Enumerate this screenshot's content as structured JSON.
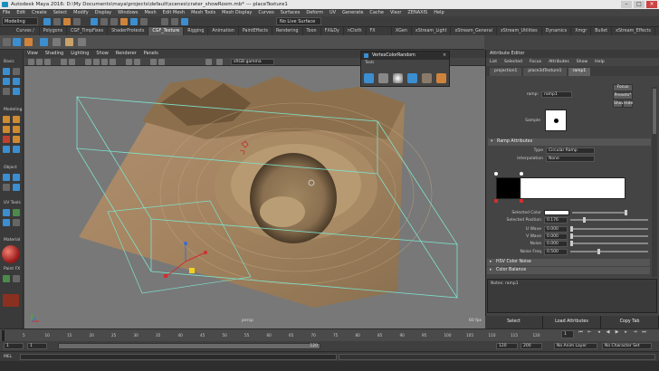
{
  "window": {
    "title": "Autodesk Maya 2016: D:\\My Documents\\maya\\projects\\default\\scenes\\crater_showRoom.mb*  ---  placeTexture1",
    "buttons": [
      "–",
      "□",
      "×"
    ]
  },
  "menubar": [
    "File",
    "Edit",
    "Create",
    "Select",
    "Modify",
    "Display",
    "Windows",
    "Mesh",
    "Edit Mesh",
    "Mesh Tools",
    "Mesh Display",
    "Curves",
    "Surfaces",
    "Deform",
    "UV",
    "Generate",
    "Cache",
    "Visor",
    "ZENAXIS",
    "Help"
  ],
  "statusline": {
    "mode": "Modeling",
    "no_live_surface": "No Live Surface",
    "icons": [
      "folder-icon",
      "save-icon",
      "undo-icon",
      "redo-icon",
      "select-icon",
      "lasso-icon",
      "paint-icon",
      "snap-grid-icon",
      "snap-curve-icon",
      "snap-point-icon",
      "render-icon",
      "ipr-icon",
      "render-settings-icon"
    ]
  },
  "shelf_tabs": [
    "Curves / Surfaces",
    "Polygons",
    "CGF_TimpFixes",
    "ShaderProtests",
    "CGF_Texture",
    "Rigging",
    "Animation",
    "PaintEffects",
    "Rendering",
    "Toon",
    "FX&Dy",
    "nCloth",
    "FX Caching",
    "XGen",
    "xStream_Light",
    "xStream_General",
    "xStream_Utilities",
    "Dynamics",
    "Xmgr",
    "Bullet",
    "xStream_Effects",
    "AdvSkeleton"
  ],
  "shelf_active": 4,
  "toolbox": {
    "labels": [
      "Basic",
      "Modeling",
      "Object",
      "UV Tools",
      "Material",
      "Paint FX"
    ]
  },
  "viewport": {
    "menu": [
      "View",
      "Shading",
      "Lighting",
      "Show",
      "Renderer",
      "Panels"
    ],
    "gamma": "sRGB gamma",
    "camera": "persp",
    "fps": "60 fps"
  },
  "tools_panel": {
    "title": "VertexColorRandom",
    "subtitle": "Tools",
    "icons": [
      "move-icon",
      "sun-icon",
      "sphere-icon",
      "brush-icon",
      "rock-icon",
      "cube-icon"
    ]
  },
  "attribute_editor": {
    "title": "Attribute Editor",
    "menu": [
      "List",
      "Selected",
      "Focus",
      "Attributes",
      "Show",
      "Help"
    ],
    "tabs": [
      "projection1",
      "place3dTexture1",
      "ramp1"
    ],
    "active_tab": 2,
    "node_label": "ramp:",
    "node_value": "ramp1",
    "buttons": [
      "Focus",
      "Presets*",
      "Show",
      "Hide"
    ],
    "sample_label": "Sample",
    "section_ramp": "Ramp Attributes",
    "type_label": "Type",
    "type_value": "Circular Ramp",
    "interp_label": "Interpolation",
    "interp_value": "None",
    "fields": [
      {
        "label": "Selected Color",
        "value": ""
      },
      {
        "label": "Selected Position",
        "value": "0.176"
      },
      {
        "label": "U Wave",
        "value": "0.000"
      },
      {
        "label": "V Wave",
        "value": "0.000"
      },
      {
        "label": "Noise",
        "value": "0.000"
      },
      {
        "label": "Noise Freq",
        "value": "0.500"
      }
    ],
    "section_hsv": "HSV Color Noise",
    "section_balance": "Color Balance",
    "notes_label": "Notes: ramp1",
    "bottom_buttons": [
      "Select",
      "Load Attributes",
      "Copy Tab"
    ]
  },
  "timeline": {
    "ticks": [
      "5",
      "10",
      "15",
      "20",
      "25",
      "30",
      "35",
      "40",
      "45",
      "50",
      "55",
      "60",
      "65",
      "70",
      "75",
      "80",
      "85",
      "90",
      "95",
      "100",
      "105",
      "110",
      "115",
      "120"
    ],
    "current_frame": "1"
  },
  "range": {
    "start": "1",
    "range_start": "1",
    "range_value": "120",
    "end": "120",
    "anim_end": "200",
    "anim_layer": "No Anim Layer",
    "char_set": "No Character Set"
  },
  "command_line": {
    "label": "MEL"
  },
  "colors": {
    "terrain": "#a08660",
    "wire": "#7ee2cc",
    "accent": "#3b8ed0"
  }
}
